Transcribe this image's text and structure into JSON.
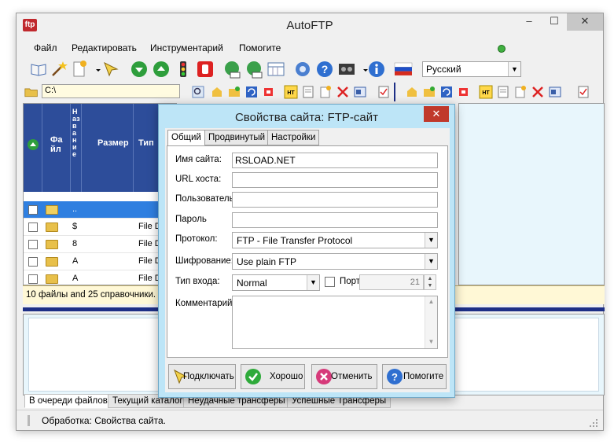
{
  "window": {
    "title": "AutoFTP",
    "app_icon": "ftp",
    "minimize": "–",
    "maximize": "☐",
    "close": "✕"
  },
  "menu": [
    "Файл",
    "Редактировать",
    "Инструментарий",
    "Помогите"
  ],
  "language": {
    "selected": "Русский"
  },
  "path": {
    "value": "C:\\"
  },
  "list": {
    "headers": {
      "col2": "Фа\nйл",
      "col3": "Название",
      "col4": "Размер",
      "col5": "Тип"
    },
    "rows": [
      {
        "name": "..",
        "type": "",
        "selected": true
      },
      {
        "name": "$",
        "type": "File D"
      },
      {
        "name": "8",
        "type": "File D"
      },
      {
        "name": "A",
        "type": "File D"
      },
      {
        "name": "A",
        "type": "File D"
      }
    ]
  },
  "status_strip": "10 файлы and 25 справочники. Об",
  "bottom_tabs": [
    "В очереди файлов",
    "Текущий каталог",
    "Неудачные трансферы",
    "Успешные Трансферы"
  ],
  "statusbar": {
    "text": "Обработка:  Свойства сайта."
  },
  "dialog": {
    "title": "Свойства сайта:  FTP-сайт",
    "close": "✕",
    "tabs": [
      "Общий",
      "Продвинутый",
      "Настройки"
    ],
    "fields": {
      "site_name_label": "Имя сайта:",
      "site_name_value": "RSLOAD.NET",
      "host_label": "URL хоста:",
      "host_value": "",
      "user_label": "Пользователь",
      "user_value": "",
      "password_label": "Пароль",
      "password_value": "",
      "protocol_label": "Протокол:",
      "protocol_value": "FTP - File Transfer Protocol",
      "encryption_label": "Шифрование:",
      "encryption_value": "Use plain FTP",
      "login_type_label": "Тип входа:",
      "login_type_value": "Normal",
      "port_label": "Порт",
      "port_value": "21",
      "comment_label": "Комментарий"
    },
    "buttons": {
      "connect": "Подключать",
      "ok": "Хорошо",
      "cancel": "Отменить",
      "help": "Помогите"
    }
  },
  "colors": {
    "list_header": "#2d4d9a",
    "selection": "#2f7fe0",
    "dialog_frame": "#bde5f7",
    "close_red": "#c0392b",
    "divider": "#1d2f86"
  }
}
